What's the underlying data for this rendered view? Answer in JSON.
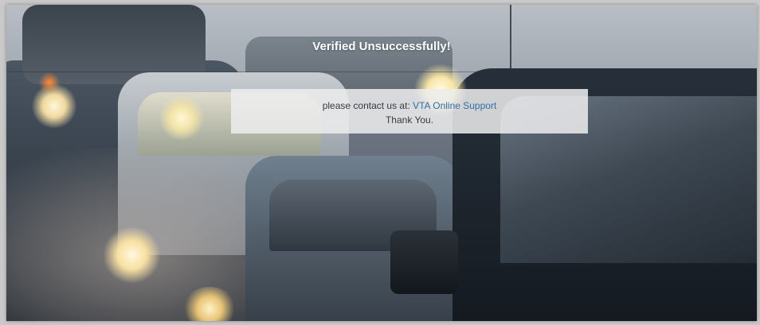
{
  "status": {
    "title": "Verified Unsuccessfully!"
  },
  "message": {
    "contact_prefix": "please contact us at:",
    "support_link_label": "VTA Online Support",
    "thanks": "Thank You."
  },
  "colors": {
    "link": "#2f6fa8",
    "title_text": "#ffffff",
    "message_box_bg": "#ececee"
  }
}
